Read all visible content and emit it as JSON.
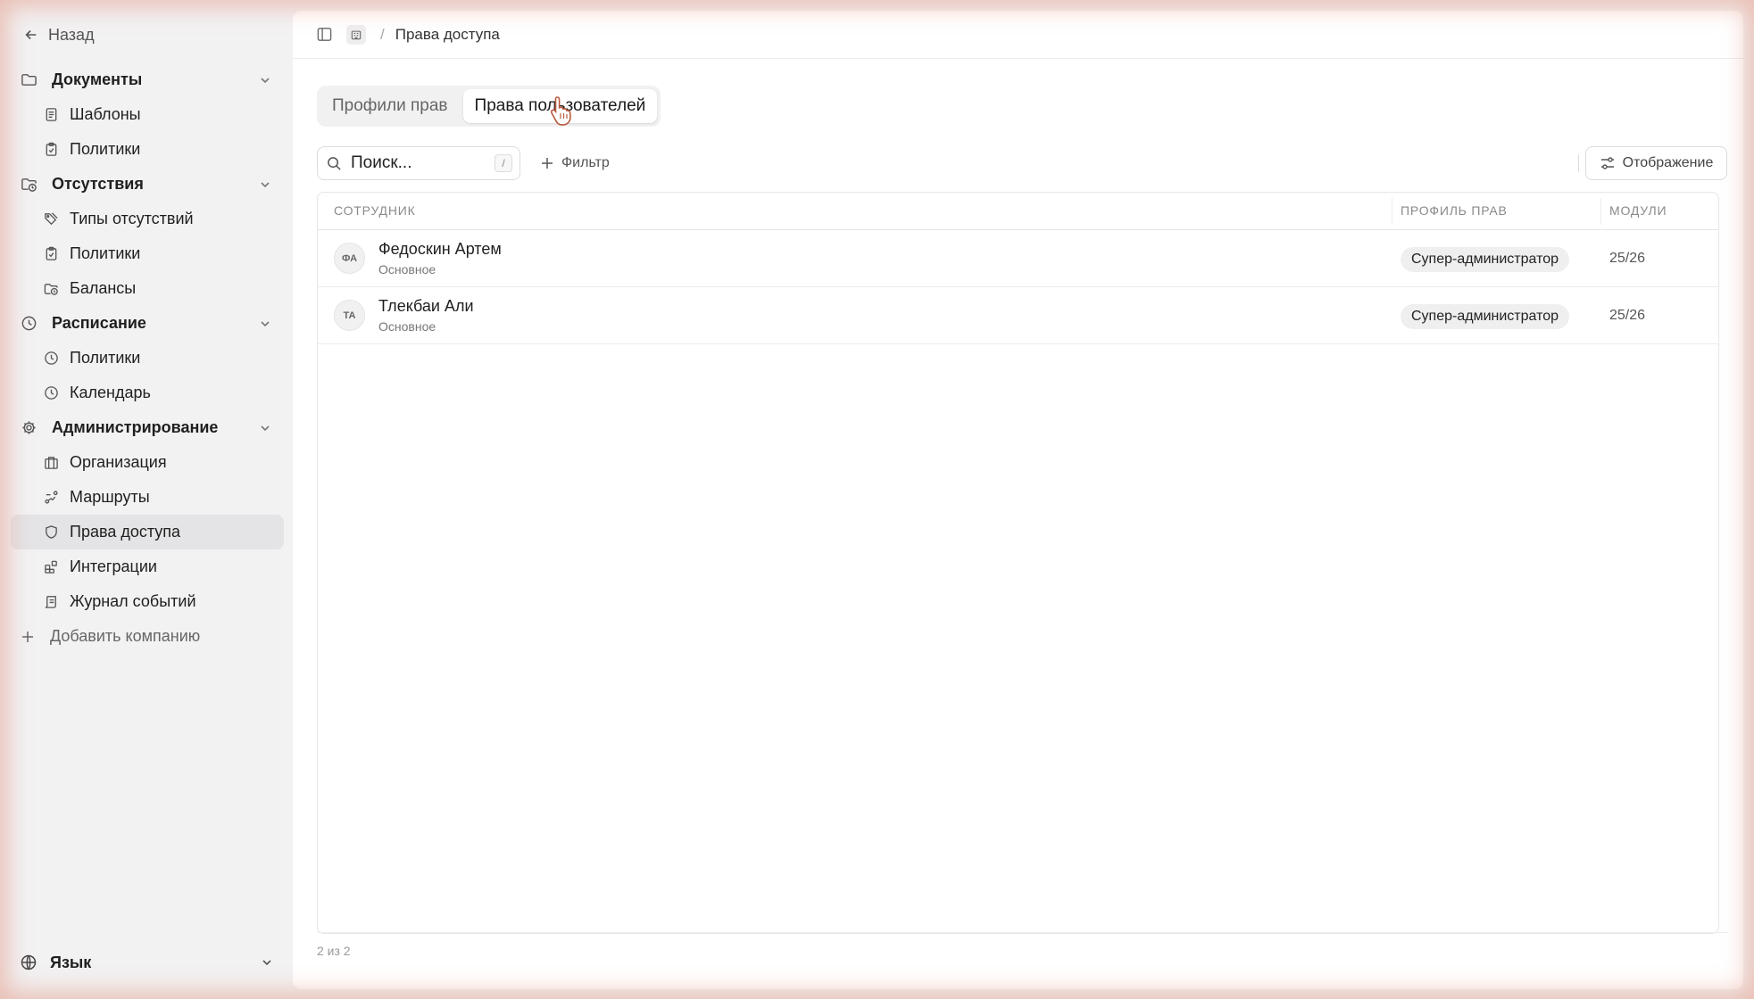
{
  "sidebar": {
    "back_label": "Назад",
    "sections": [
      {
        "label": "Документы",
        "items": [
          {
            "label": "Шаблоны"
          },
          {
            "label": "Политики"
          }
        ]
      },
      {
        "label": "Отсутствия",
        "items": [
          {
            "label": "Типы отсутствий"
          },
          {
            "label": "Политики"
          },
          {
            "label": "Балансы"
          }
        ]
      },
      {
        "label": "Расписание",
        "items": [
          {
            "label": "Политики"
          },
          {
            "label": "Календарь"
          }
        ]
      },
      {
        "label": "Администрирование",
        "items": [
          {
            "label": "Организация"
          },
          {
            "label": "Маршруты"
          },
          {
            "label": "Права доступа"
          },
          {
            "label": "Интеграции"
          },
          {
            "label": "Журнал событий"
          }
        ]
      }
    ],
    "add_company_label": "Добавить компанию",
    "language_label": "Язык"
  },
  "breadcrumb": {
    "current": "Права доступа"
  },
  "tabs": [
    {
      "label": "Профили прав"
    },
    {
      "label": "Права пользователей"
    }
  ],
  "search": {
    "placeholder": "Поиск...",
    "shortcut": "/"
  },
  "filter_label": "Фильтр",
  "display_label": "Отображение",
  "table": {
    "headers": {
      "employee": "СОТРУДНИК",
      "profile": "ПРОФИЛЬ ПРАВ",
      "modules": "МОДУЛИ"
    },
    "rows": [
      {
        "initials": "ФА",
        "name": "Федоскин Артем",
        "sub": "Основное",
        "profile": "Супер-администратор",
        "modules": "25/26"
      },
      {
        "initials": "ТА",
        "name": "Тлекбаи Али",
        "sub": "Основное",
        "profile": "Супер-администратор",
        "modules": "25/26"
      }
    ]
  },
  "footer": {
    "count": "2 из 2"
  }
}
